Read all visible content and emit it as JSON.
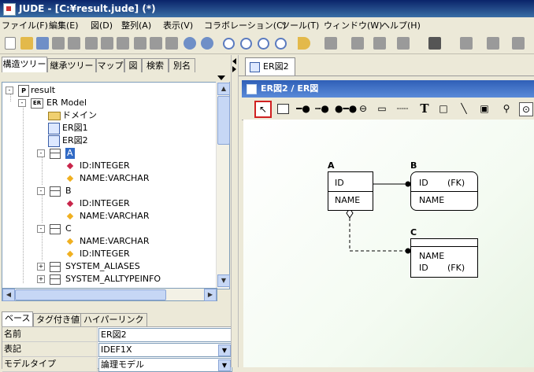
{
  "window": {
    "title": "JUDE - [C:¥result.jude] (*)"
  },
  "menu": [
    "ファイル(F)",
    "編集(E)",
    "図(D)",
    "整列(A)",
    "表示(V)",
    "コラボレーション(C)",
    "ツール(T)",
    "ウィンドウ(W)",
    "ヘルプ(H)"
  ],
  "left_tabs": [
    "構造ツリー",
    "継承ツリー",
    "マップ",
    "図",
    "検索",
    "別名"
  ],
  "tree": {
    "root": "result",
    "er_model": "ER Model",
    "folder": "ドメイン",
    "diagram1": "ER図1",
    "diagram2": "ER図2",
    "entity_a": "A",
    "a_attrs": [
      "ID:INTEGER",
      "NAME:VARCHAR"
    ],
    "entity_b": "B",
    "b_attrs": [
      "ID:INTEGER",
      "NAME:VARCHAR"
    ],
    "entity_c": "C",
    "c_attrs": [
      "NAME:VARCHAR",
      "ID:INTEGER"
    ],
    "sys1": "SYSTEM_ALIASES",
    "sys2": "SYSTEM_ALLTYPEINFO"
  },
  "prop_tabs": [
    "ベース",
    "タグ付き値",
    "ハイパーリンク"
  ],
  "props": [
    {
      "label": "名前",
      "value": "ER図2"
    },
    {
      "label": "表記",
      "value": "IDEF1X"
    },
    {
      "label": "モデルタイプ",
      "value": "論理モデル"
    }
  ],
  "doc_tab": "ER図2",
  "diagram_title": "ER図2 / ER図",
  "diagram_tools": {
    "text_tool": "T"
  },
  "entities": {
    "a": {
      "label": "A",
      "key": "ID",
      "attr": "NAME"
    },
    "b": {
      "label": "B",
      "key": "ID",
      "key_fk": "(FK)",
      "attr": "NAME"
    },
    "c": {
      "label": "C",
      "attr1": "NAME",
      "attr2": "ID",
      "attr2_fk": "(FK)"
    }
  },
  "colors": {
    "title_bar": "#0a246a",
    "selected_tool_border": "#d02020",
    "selection": "#316ac5"
  }
}
